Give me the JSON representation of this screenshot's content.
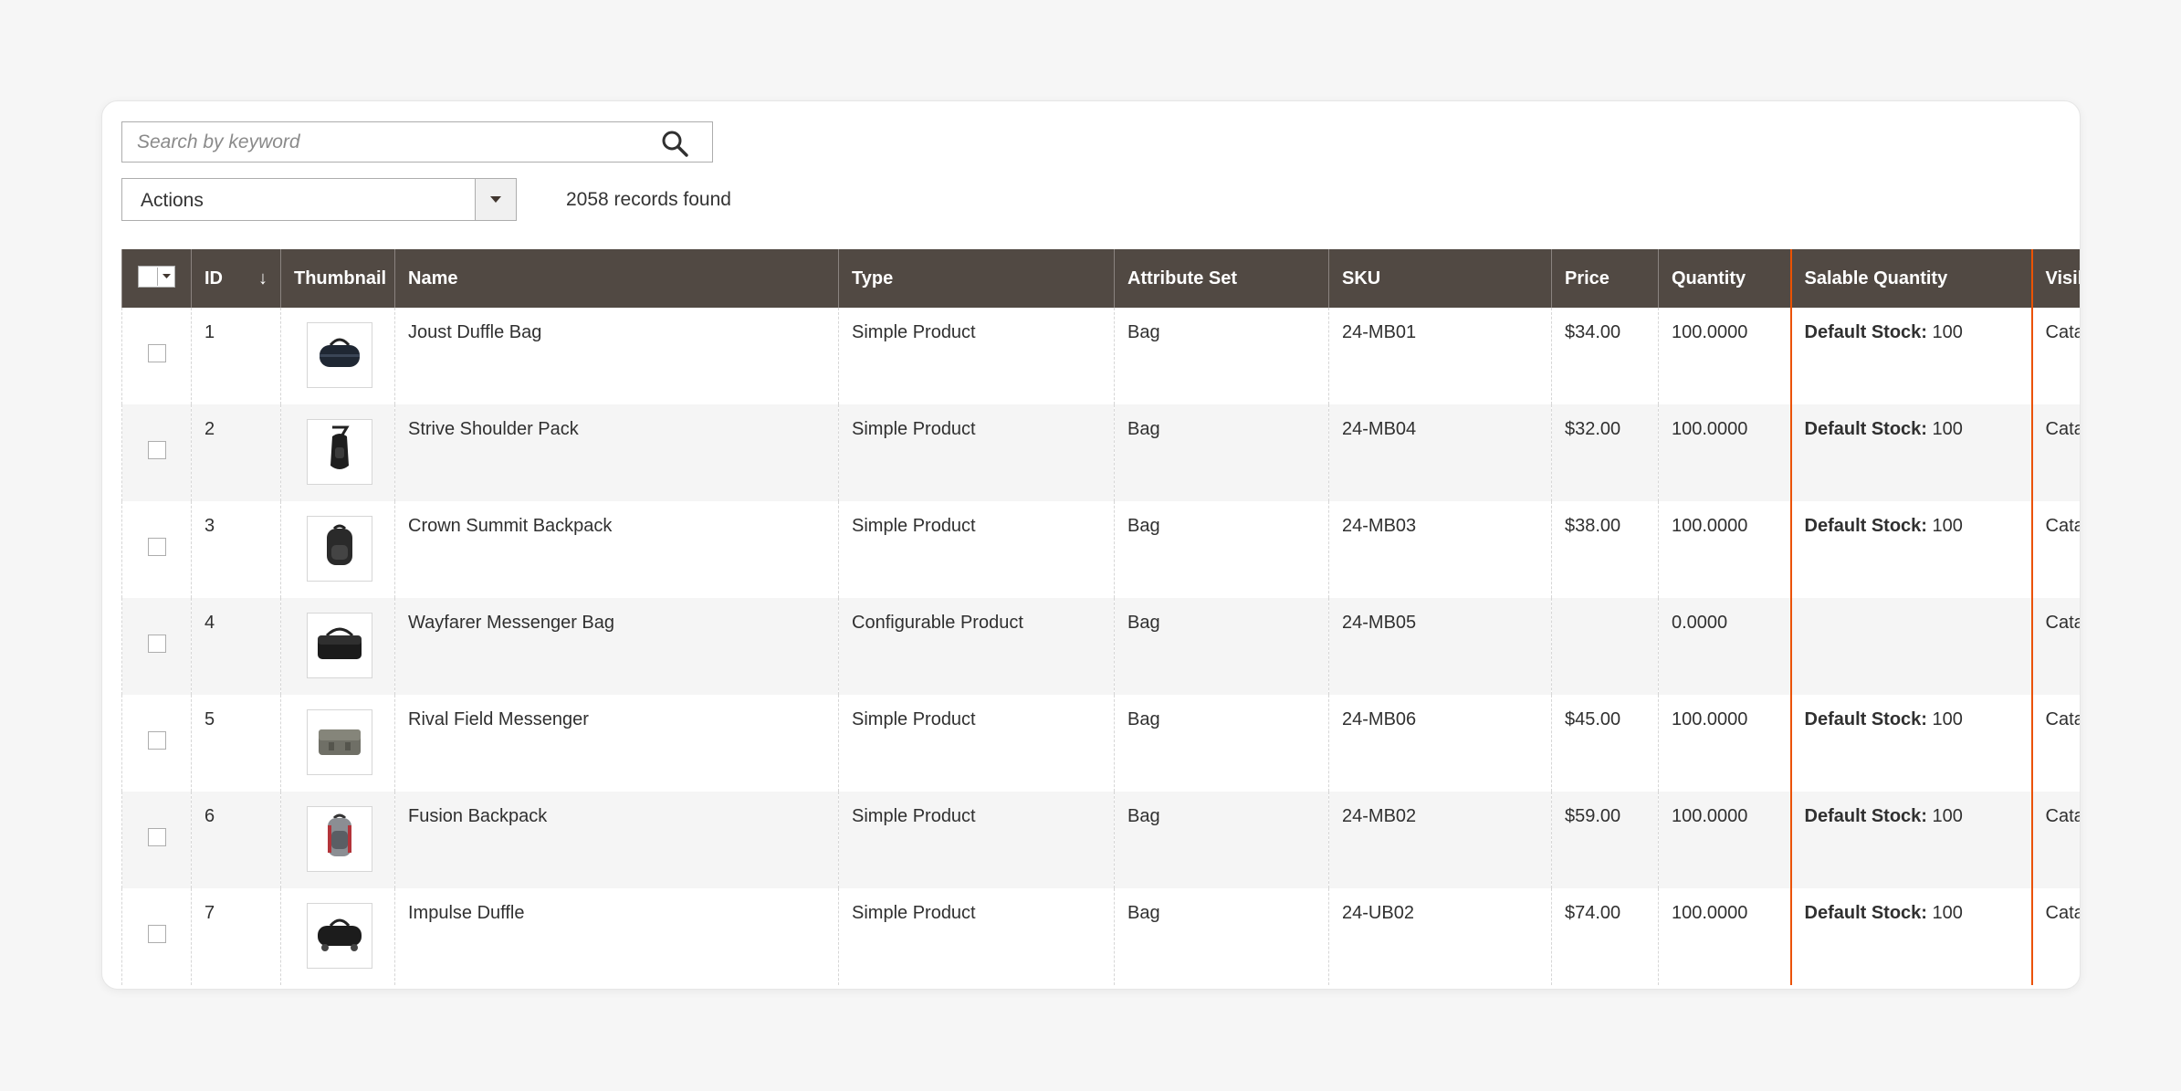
{
  "search": {
    "placeholder": "Search by keyword"
  },
  "actions": {
    "label": "Actions"
  },
  "records": {
    "text": "2058 records found"
  },
  "columns": {
    "id": "ID",
    "sort_indicator": "↓",
    "thumbnail": "Thumbnail",
    "name": "Name",
    "type": "Type",
    "attribute_set": "Attribute Set",
    "sku": "SKU",
    "price": "Price",
    "quantity": "Quantity",
    "salable_quantity": "Salable Quantity",
    "visibility": "Visib"
  },
  "rows": [
    {
      "id": "1",
      "name": "Joust Duffle Bag",
      "type": "Simple Product",
      "attribute_set": "Bag",
      "sku": "24-MB01",
      "price": "$34.00",
      "quantity": "100.0000",
      "stock_label": "Default Stock:",
      "stock_value": " 100",
      "visibility": "Cata",
      "thumb_icon": "duffle-bag-icon"
    },
    {
      "id": "2",
      "name": "Strive Shoulder Pack",
      "type": "Simple Product",
      "attribute_set": "Bag",
      "sku": "24-MB04",
      "price": "$32.00",
      "quantity": "100.0000",
      "stock_label": "Default Stock:",
      "stock_value": " 100",
      "visibility": "Cata",
      "thumb_icon": "shoulder-pack-icon"
    },
    {
      "id": "3",
      "name": "Crown Summit Backpack",
      "type": "Simple Product",
      "attribute_set": "Bag",
      "sku": "24-MB03",
      "price": "$38.00",
      "quantity": "100.0000",
      "stock_label": "Default Stock:",
      "stock_value": " 100",
      "visibility": "Cata",
      "thumb_icon": "backpack-icon"
    },
    {
      "id": "4",
      "name": "Wayfarer Messenger Bag",
      "type": "Configurable Product",
      "attribute_set": "Bag",
      "sku": "24-MB05",
      "price": "",
      "quantity": "0.0000",
      "stock_label": "",
      "stock_value": "",
      "visibility": "Cata",
      "thumb_icon": "messenger-bag-icon"
    },
    {
      "id": "5",
      "name": "Rival Field Messenger",
      "type": "Simple Product",
      "attribute_set": "Bag",
      "sku": "24-MB06",
      "price": "$45.00",
      "quantity": "100.0000",
      "stock_label": "Default Stock:",
      "stock_value": " 100",
      "visibility": "Cata",
      "thumb_icon": "field-messenger-icon"
    },
    {
      "id": "6",
      "name": "Fusion Backpack",
      "type": "Simple Product",
      "attribute_set": "Bag",
      "sku": "24-MB02",
      "price": "$59.00",
      "quantity": "100.0000",
      "stock_label": "Default Stock:",
      "stock_value": " 100",
      "visibility": "Cata",
      "thumb_icon": "fusion-backpack-icon"
    },
    {
      "id": "7",
      "name": "Impulse Duffle",
      "type": "Simple Product",
      "attribute_set": "Bag",
      "sku": "24-UB02",
      "price": "$74.00",
      "quantity": "100.0000",
      "stock_label": "Default Stock:",
      "stock_value": " 100",
      "visibility": "Cata",
      "thumb_icon": "impulse-duffle-icon"
    }
  ],
  "colors": {
    "header_bg": "#514943",
    "highlight": "#eb5202",
    "row_alt": "#f5f5f5"
  }
}
